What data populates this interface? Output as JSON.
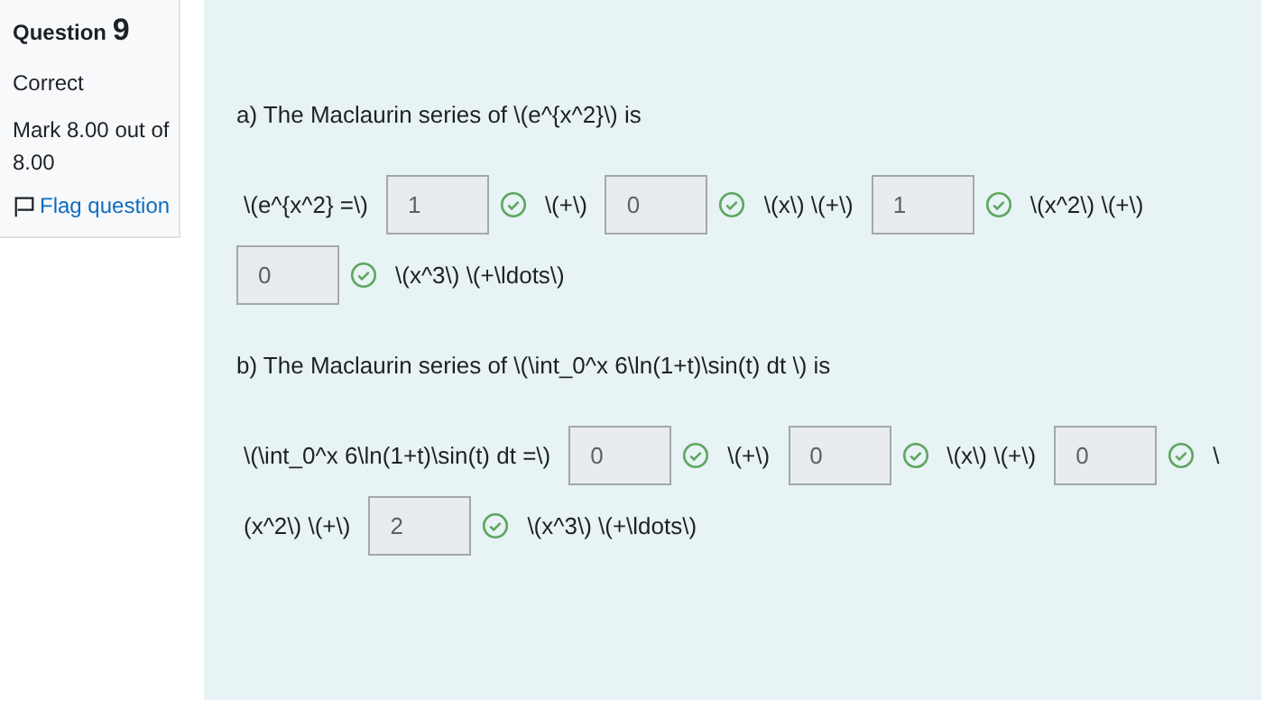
{
  "info": {
    "label": "Question",
    "number": "9",
    "status": "Correct",
    "mark": "Mark 8.00 out of 8.00",
    "flag": {
      "label": "Flag question",
      "flagged": false
    }
  },
  "parts": [
    {
      "prompt": "a) The Maclaurin series of \\(e^{x^2}\\) is",
      "lines": [
        [
          {
            "kind": "text",
            "text": "\\(e^{x^2} =\\)"
          },
          {
            "kind": "input",
            "value": "1",
            "correct": true
          },
          {
            "kind": "text",
            "text": "\\(+\\)"
          },
          {
            "kind": "input",
            "value": "0",
            "correct": true
          },
          {
            "kind": "text",
            "text": "\\(x\\) \\(+\\)"
          },
          {
            "kind": "input",
            "value": "1",
            "correct": true
          },
          {
            "kind": "text",
            "text": "\\(x^2\\) \\(+\\)"
          }
        ],
        [
          {
            "kind": "input",
            "value": "0",
            "correct": true
          },
          {
            "kind": "text",
            "text": "\\(x^3\\) \\(+\\ldots\\)"
          }
        ]
      ]
    },
    {
      "prompt": "b) The Maclaurin series of \\(\\int_0^x 6\\ln(1+t)\\sin(t) dt \\) is",
      "lines": [
        [
          {
            "kind": "text",
            "text": "\\(\\int_0^x 6\\ln(1+t)\\sin(t) dt =\\)"
          },
          {
            "kind": "input",
            "value": "0",
            "correct": true
          },
          {
            "kind": "text",
            "text": "\\(+\\)"
          },
          {
            "kind": "input",
            "value": "0",
            "correct": true
          },
          {
            "kind": "text",
            "text": "\\(x\\) \\(+\\)"
          },
          {
            "kind": "input",
            "value": "0",
            "correct": true
          },
          {
            "kind": "text",
            "text": "\\"
          }
        ],
        [
          {
            "kind": "text",
            "text": "(x^2\\) \\(+\\)"
          },
          {
            "kind": "input",
            "value": "2",
            "correct": true
          },
          {
            "kind": "text",
            "text": "\\(x^3\\) \\(+\\ldots\\)"
          }
        ]
      ]
    }
  ]
}
